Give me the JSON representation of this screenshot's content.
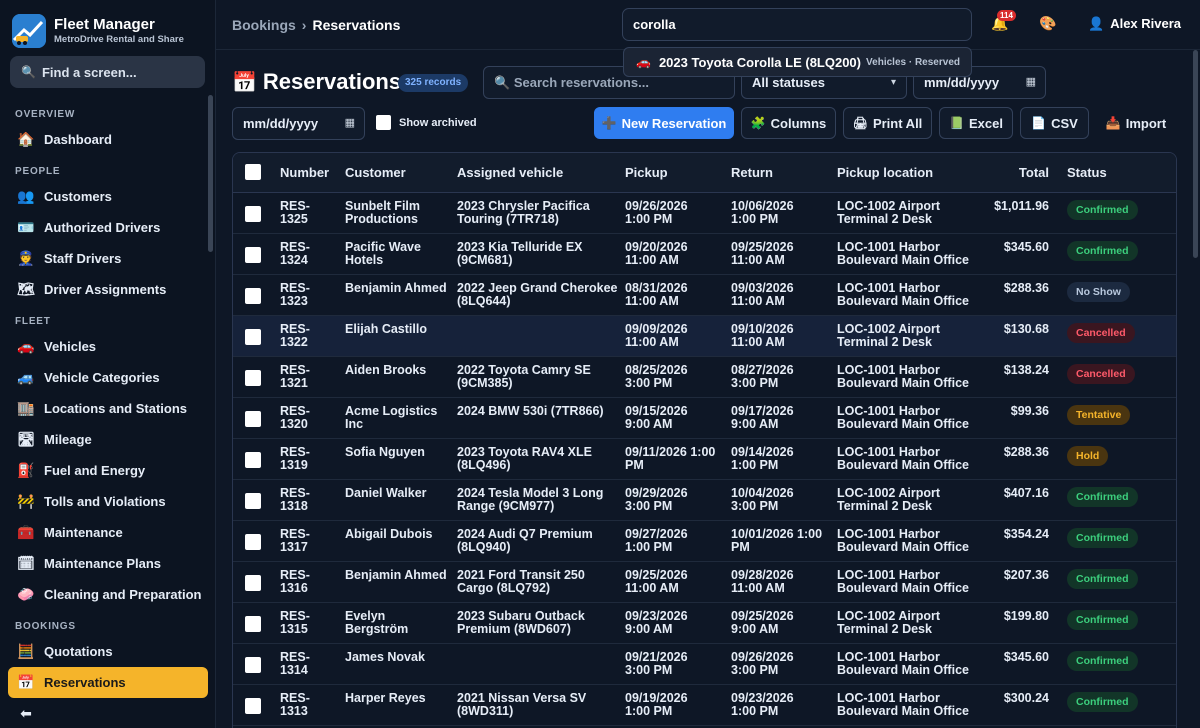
{
  "app": {
    "name": "Fleet Manager",
    "subtitle": "MetroDrive Rental and Share"
  },
  "sidebar": {
    "find_label": "Find a screen...",
    "sections": [
      {
        "label": "OVERVIEW",
        "items": [
          {
            "label": "Dashboard",
            "icon": "house-icon",
            "glyph": "🏠"
          }
        ]
      },
      {
        "label": "PEOPLE",
        "items": [
          {
            "label": "Customers",
            "icon": "people-icon",
            "glyph": "👥"
          },
          {
            "label": "Authorized Drivers",
            "icon": "id-card-icon",
            "glyph": "🪪"
          },
          {
            "label": "Staff Drivers",
            "icon": "police-officer-icon",
            "glyph": "👮"
          },
          {
            "label": "Driver Assignments",
            "icon": "map-icon",
            "glyph": "🗺"
          }
        ]
      },
      {
        "label": "FLEET",
        "items": [
          {
            "label": "Vehicles",
            "icon": "car-icon",
            "glyph": "🚗"
          },
          {
            "label": "Vehicle Categories",
            "icon": "suv-icon",
            "glyph": "🚙"
          },
          {
            "label": "Locations and Stations",
            "icon": "building-icon",
            "glyph": "🏬"
          },
          {
            "label": "Mileage",
            "icon": "road-icon",
            "glyph": "🛣"
          },
          {
            "label": "Fuel and Energy",
            "icon": "fuel-pump-icon",
            "glyph": "⛽"
          },
          {
            "label": "Tolls and Violations",
            "icon": "barrier-icon",
            "glyph": "🚧"
          },
          {
            "label": "Maintenance",
            "icon": "toolbox-icon",
            "glyph": "🧰"
          },
          {
            "label": "Maintenance Plans",
            "icon": "calendar-icon",
            "glyph": "🗓"
          },
          {
            "label": "Cleaning and Preparation",
            "icon": "soap-icon",
            "glyph": "🧼"
          }
        ]
      },
      {
        "label": "BOOKINGS",
        "items": [
          {
            "label": "Quotations",
            "icon": "abacus-icon",
            "glyph": "🧮"
          },
          {
            "label": "Reservations",
            "icon": "calendar-icon",
            "glyph": "📅",
            "active": true
          },
          {
            "label": "",
            "icon": "back-arrow-icon",
            "glyph": "⬅"
          }
        ]
      }
    ]
  },
  "topbar": {
    "breadcrumb": [
      "Bookings",
      "Reservations"
    ],
    "search_value": "corolla",
    "notifications": "114",
    "user": "Alex Rivera"
  },
  "suggestion": {
    "label": "2023 Toyota Corolla LE (8LQ200)",
    "meta": "Vehicles · Reserved"
  },
  "page": {
    "title": "Reservations",
    "records": "325 records",
    "search_placeholder": "Search reservations...",
    "status_filter": "All statuses",
    "date_placeholder": "mm/dd/yyyy",
    "show_archived": "Show archived"
  },
  "toolbar": {
    "new": "New Reservation",
    "columns": "Columns",
    "print": "Print All",
    "excel": "Excel",
    "csv": "CSV",
    "import": "Import"
  },
  "table": {
    "columns": [
      "Number",
      "Customer",
      "Assigned vehicle",
      "Pickup",
      "Return",
      "Pickup location",
      "Total",
      "Status"
    ],
    "rows": [
      {
        "num": [
          "RES-",
          "1325"
        ],
        "cust": [
          "Sunbelt Film",
          "Productions"
        ],
        "veh": [
          "2023 Chrysler Pacifica",
          "Touring (7TR718)"
        ],
        "pick": [
          "09/26/2026",
          "1:00 PM"
        ],
        "ret": [
          "10/06/2026",
          "1:00 PM"
        ],
        "loc": [
          "LOC-1002 Airport",
          "Terminal 2 Desk"
        ],
        "total": "$1,011.96",
        "status": "Confirmed",
        "cls": "b-confirmed"
      },
      {
        "num": [
          "RES-",
          "1324"
        ],
        "cust": [
          "Pacific Wave",
          "Hotels"
        ],
        "veh": [
          "2023 Kia Telluride EX",
          "(9CM681)"
        ],
        "pick": [
          "09/20/2026",
          "11:00 AM"
        ],
        "ret": [
          "09/25/2026",
          "11:00 AM"
        ],
        "loc": [
          "LOC-1001 Harbor",
          "Boulevard Main Office"
        ],
        "total": "$345.60",
        "status": "Confirmed",
        "cls": "b-confirmed"
      },
      {
        "num": [
          "RES-",
          "1323"
        ],
        "cust": [
          "Benjamin Ahmed",
          ""
        ],
        "veh": [
          "2022 Jeep Grand Cherokee",
          "(8LQ644)"
        ],
        "pick": [
          "08/31/2026",
          "11:00 AM"
        ],
        "ret": [
          "09/03/2026",
          "11:00 AM"
        ],
        "loc": [
          "LOC-1001 Harbor",
          "Boulevard Main Office"
        ],
        "total": "$288.36",
        "status": "No Show",
        "cls": "b-noshow"
      },
      {
        "num": [
          "RES-",
          "1322"
        ],
        "cust": [
          "Elijah Castillo",
          ""
        ],
        "veh": [
          "",
          ""
        ],
        "pick": [
          "09/09/2026",
          "11:00 AM"
        ],
        "ret": [
          "09/10/2026",
          "11:00 AM"
        ],
        "loc": [
          "LOC-1002 Airport",
          "Terminal 2 Desk"
        ],
        "total": "$130.68",
        "status": "Cancelled",
        "cls": "b-cancelled",
        "hl": true
      },
      {
        "num": [
          "RES-",
          "1321"
        ],
        "cust": [
          "Aiden Brooks",
          ""
        ],
        "veh": [
          "2022 Toyota Camry SE",
          "(9CM385)"
        ],
        "pick": [
          "08/25/2026",
          "3:00 PM"
        ],
        "ret": [
          "08/27/2026",
          "3:00 PM"
        ],
        "loc": [
          "LOC-1001 Harbor",
          "Boulevard Main Office"
        ],
        "total": "$138.24",
        "status": "Cancelled",
        "cls": "b-cancelled"
      },
      {
        "num": [
          "RES-",
          "1320"
        ],
        "cust": [
          "Acme Logistics",
          "Inc"
        ],
        "veh": [
          "2024 BMW 530i (7TR866)",
          ""
        ],
        "pick": [
          "09/15/2026",
          "9:00 AM"
        ],
        "ret": [
          "09/17/2026",
          "9:00 AM"
        ],
        "loc": [
          "LOC-1001 Harbor",
          "Boulevard Main Office"
        ],
        "total": "$99.36",
        "status": "Tentative",
        "cls": "b-tentative"
      },
      {
        "num": [
          "RES-",
          "1319"
        ],
        "cust": [
          "Sofia Nguyen",
          ""
        ],
        "veh": [
          "2023 Toyota RAV4 XLE",
          "(8LQ496)"
        ],
        "pick": [
          "09/11/2026 1:00",
          "PM"
        ],
        "ret": [
          "09/14/2026",
          "1:00 PM"
        ],
        "loc": [
          "LOC-1001 Harbor",
          "Boulevard Main Office"
        ],
        "total": "$288.36",
        "status": "Hold",
        "cls": "b-hold"
      },
      {
        "num": [
          "RES-",
          "1318"
        ],
        "cust": [
          "Daniel Walker",
          ""
        ],
        "veh": [
          "2024 Tesla Model 3 Long",
          "Range (9CM977)"
        ],
        "pick": [
          "09/29/2026",
          "3:00 PM"
        ],
        "ret": [
          "10/04/2026",
          "3:00 PM"
        ],
        "loc": [
          "LOC-1002 Airport",
          "Terminal 2 Desk"
        ],
        "total": "$407.16",
        "status": "Confirmed",
        "cls": "b-confirmed"
      },
      {
        "num": [
          "RES-",
          "1317"
        ],
        "cust": [
          "Abigail Dubois",
          ""
        ],
        "veh": [
          "2024 Audi Q7 Premium",
          "(8LQ940)"
        ],
        "pick": [
          "09/27/2026",
          "1:00 PM"
        ],
        "ret": [
          "10/01/2026 1:00",
          "PM"
        ],
        "loc": [
          "LOC-1001 Harbor",
          "Boulevard Main Office"
        ],
        "total": "$354.24",
        "status": "Confirmed",
        "cls": "b-confirmed"
      },
      {
        "num": [
          "RES-",
          "1316"
        ],
        "cust": [
          "Benjamin Ahmed",
          ""
        ],
        "veh": [
          "2021 Ford Transit 250",
          "Cargo (8LQ792)"
        ],
        "pick": [
          "09/25/2026",
          "11:00 AM"
        ],
        "ret": [
          "09/28/2026",
          "11:00 AM"
        ],
        "loc": [
          "LOC-1001 Harbor",
          "Boulevard Main Office"
        ],
        "total": "$207.36",
        "status": "Confirmed",
        "cls": "b-confirmed"
      },
      {
        "num": [
          "RES-",
          "1315"
        ],
        "cust": [
          "Evelyn",
          "Bergström"
        ],
        "veh": [
          "2023 Subaru Outback",
          "Premium (8WD607)"
        ],
        "pick": [
          "09/23/2026",
          "9:00 AM"
        ],
        "ret": [
          "09/25/2026",
          "9:00 AM"
        ],
        "loc": [
          "LOC-1002 Airport",
          "Terminal 2 Desk"
        ],
        "total": "$199.80",
        "status": "Confirmed",
        "cls": "b-confirmed"
      },
      {
        "num": [
          "RES-",
          "1314"
        ],
        "cust": [
          "James Novak",
          ""
        ],
        "veh": [
          "",
          ""
        ],
        "pick": [
          "09/21/2026",
          "3:00 PM"
        ],
        "ret": [
          "09/26/2026",
          "3:00 PM"
        ],
        "loc": [
          "LOC-1001 Harbor",
          "Boulevard Main Office"
        ],
        "total": "$345.60",
        "status": "Confirmed",
        "cls": "b-confirmed"
      },
      {
        "num": [
          "RES-",
          "1313"
        ],
        "cust": [
          "Harper Reyes",
          ""
        ],
        "veh": [
          "2021 Nissan Versa SV",
          "(8WD311)"
        ],
        "pick": [
          "09/19/2026",
          "1:00 PM"
        ],
        "ret": [
          "09/23/2026",
          "1:00 PM"
        ],
        "loc": [
          "LOC-1001 Harbor",
          "Boulevard Main Office"
        ],
        "total": "$300.24",
        "status": "Confirmed",
        "cls": "b-confirmed"
      }
    ]
  }
}
